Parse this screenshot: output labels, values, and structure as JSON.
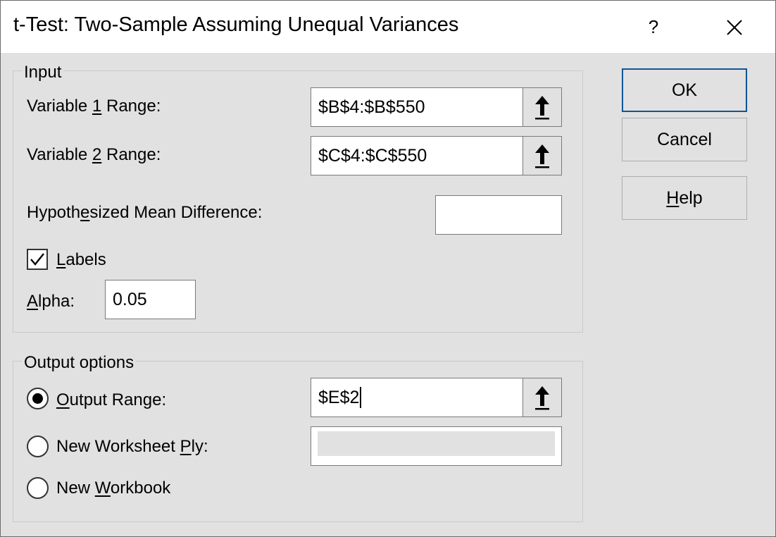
{
  "window": {
    "title": "t-Test: Two-Sample Assuming Unequal Variances",
    "help_glyph": "?",
    "close_icon": "close-icon"
  },
  "input_group": {
    "label": "Input",
    "var1": {
      "pre": "Variable ",
      "key": "1",
      "post": " Range:",
      "value": "$B$4:$B$550"
    },
    "var2": {
      "pre": "Variable ",
      "key": "2",
      "post": " Range:",
      "value": "$C$4:$C$550"
    },
    "hyp": {
      "pre": "Hypoth",
      "key": "e",
      "post": "sized Mean Difference:",
      "value": ""
    },
    "labels": {
      "key": "L",
      "post": "abels",
      "checked": true
    },
    "alpha": {
      "key": "A",
      "post": "lpha:",
      "value": "0.05"
    }
  },
  "output_group": {
    "label": "Output options",
    "output_range": {
      "key": "O",
      "post": "utput Range:",
      "value": "$E$2",
      "selected": true
    },
    "new_ply": {
      "pre": "New Worksheet ",
      "key": "P",
      "post": "ly:",
      "value": ""
    },
    "new_workbook": {
      "pre": "New ",
      "key": "W",
      "post": "orkbook"
    }
  },
  "buttons": {
    "ok": "OK",
    "cancel": "Cancel",
    "help": {
      "key": "H",
      "post": "elp"
    }
  },
  "icons": {
    "range_picker": "arrow-up-icon",
    "checkbox_mark": "checkmark-icon"
  }
}
